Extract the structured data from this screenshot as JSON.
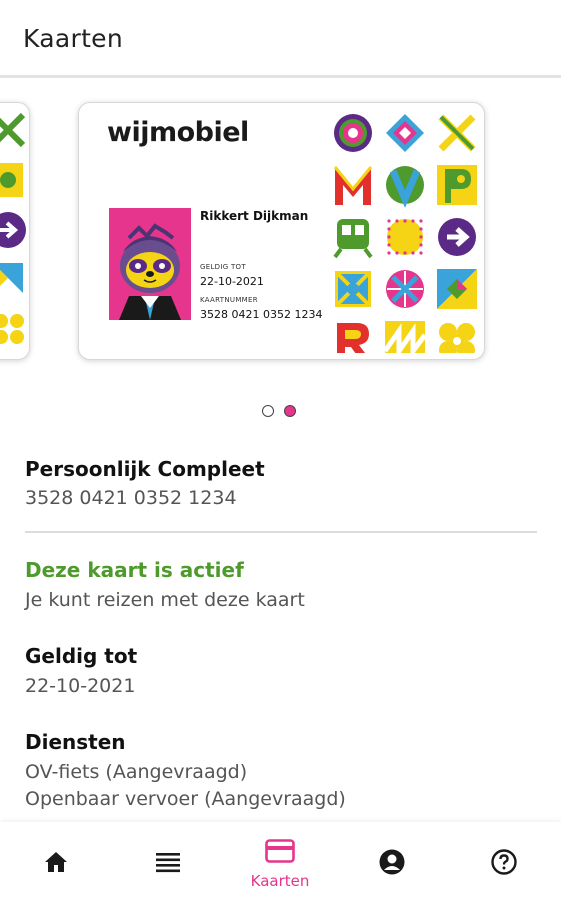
{
  "header": {
    "title": "Kaarten"
  },
  "card": {
    "brand": "wijmobiel",
    "holder_name": "Rikkert Dijkman",
    "valid_label": "GELDIG TOT",
    "valid_date": "22-10-2021",
    "number_label": "KAARTNUMMER",
    "number": "3528 0421 0352 1234",
    "avatar_icon": "sloth-avatar-icon",
    "colors": {
      "pink": "#e6358c",
      "green": "#4f9a2d",
      "purple": "#5b2a86",
      "yellow": "#f5d315",
      "red": "#e2312d",
      "blue": "#3aa3d9"
    }
  },
  "carousel": {
    "pages": 2,
    "active_index": 1
  },
  "details": {
    "product_title": "Persoonlijk Compleet",
    "product_number": "3528 0421 0352 1234",
    "status_title": "Deze kaart is actief",
    "status_text": "Je kunt reizen met deze kaart",
    "valid_title": "Geldig tot",
    "valid_value": "22-10-2021",
    "services_title": "Diensten",
    "services": [
      "OV-fiets (Aangevraagd)",
      "Openbaar vervoer (Aangevraagd)"
    ]
  },
  "bottom_nav": {
    "items": [
      {
        "icon": "home-icon",
        "label": ""
      },
      {
        "icon": "list-icon",
        "label": ""
      },
      {
        "icon": "card-icon",
        "label": "Kaarten",
        "active": true
      },
      {
        "icon": "account-icon",
        "label": ""
      },
      {
        "icon": "help-icon",
        "label": ""
      }
    ],
    "active_color": "#e6358c"
  }
}
